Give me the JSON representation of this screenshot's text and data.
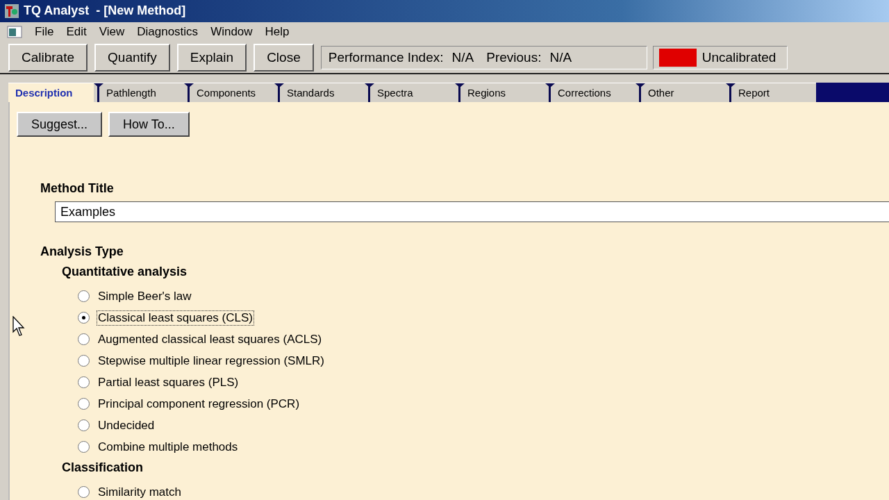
{
  "window": {
    "title": "TQ Analyst  - [New Method]"
  },
  "menu": [
    "File",
    "Edit",
    "View",
    "Diagnostics",
    "Window",
    "Help"
  ],
  "toolbar": {
    "buttons": [
      "Calibrate",
      "Quantify",
      "Explain",
      "Close"
    ],
    "performance": {
      "label": "Performance Index:",
      "value": "N/A",
      "previous_label": "Previous:",
      "previous_value": "N/A"
    },
    "status": {
      "color": "#e00000",
      "text": "Uncalibrated"
    }
  },
  "tabs": [
    {
      "label": "Description",
      "selected": true
    },
    {
      "label": "Pathlength",
      "selected": false
    },
    {
      "label": "Components",
      "selected": false
    },
    {
      "label": "Standards",
      "selected": false
    },
    {
      "label": "Spectra",
      "selected": false
    },
    {
      "label": "Regions",
      "selected": false
    },
    {
      "label": "Corrections",
      "selected": false
    },
    {
      "label": "Other",
      "selected": false
    },
    {
      "label": "Report",
      "selected": false
    }
  ],
  "actions": [
    "Suggest...",
    "How To..."
  ],
  "method_title": {
    "label": "Method Title",
    "value": "Examples"
  },
  "analysis_type": {
    "label": "Analysis Type",
    "groups": [
      {
        "label": "Quantitative analysis",
        "options": [
          {
            "label": "Simple Beer's law",
            "selected": false
          },
          {
            "label": "Classical least squares (CLS)",
            "selected": true
          },
          {
            "label": "Augmented classical least squares (ACLS)",
            "selected": false
          },
          {
            "label": "Stepwise multiple linear regression (SMLR)",
            "selected": false
          },
          {
            "label": "Partial least squares (PLS)",
            "selected": false
          },
          {
            "label": "Principal component regression (PCR)",
            "selected": false
          },
          {
            "label": "Undecided",
            "selected": false
          },
          {
            "label": "Combine multiple methods",
            "selected": false
          }
        ]
      },
      {
        "label": "Classification",
        "options": [
          {
            "label": "Similarity match",
            "selected": false
          }
        ]
      }
    ]
  }
}
